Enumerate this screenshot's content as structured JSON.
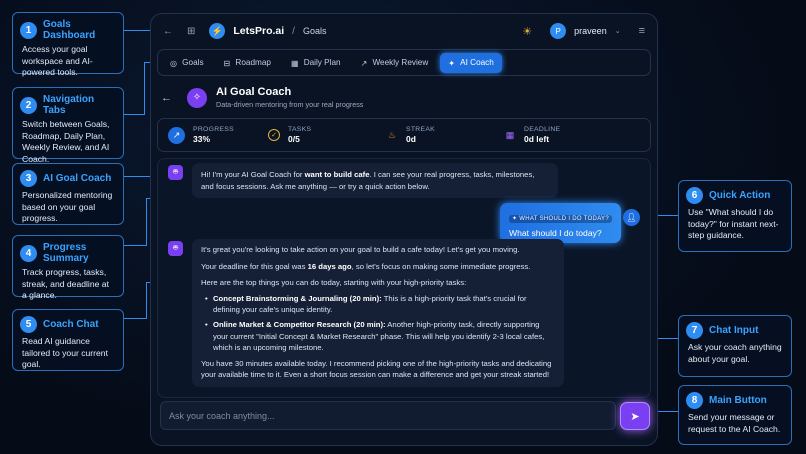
{
  "app": {
    "brand": "LetsPro.ai",
    "separator": "/",
    "breadcrumb": "Goals",
    "user": "praveen",
    "user_initial": "P"
  },
  "tabs": [
    {
      "label": "Goals",
      "icon": "target-icon"
    },
    {
      "label": "Roadmap",
      "icon": "map-icon"
    },
    {
      "label": "Daily Plan",
      "icon": "calendar-icon"
    },
    {
      "label": "Weekly Review",
      "icon": "trend-icon"
    },
    {
      "label": "AI Coach",
      "icon": "sparkle-icon",
      "active": true
    }
  ],
  "header": {
    "title": "AI Goal Coach",
    "subtitle": "Data-driven mentoring from your real progress"
  },
  "stats": [
    {
      "label": "PROGRESS",
      "value": "33%",
      "color": "#2f8cf0"
    },
    {
      "label": "TASKS",
      "value": "0/5",
      "color": "#e0b23a"
    },
    {
      "label": "STREAK",
      "value": "0d",
      "color": "#f08a2f"
    },
    {
      "label": "DEADLINE",
      "value": "0d left",
      "color": "#7b3ff2"
    }
  ],
  "chat": {
    "bot_msg1_a": "Hi! I'm your AI Goal Coach for ",
    "bot_msg1_b": "want to build cafe",
    "bot_msg1_c": ". I can see your real progress, tasks, milestones, and focus sessions. Ask me anything — or try a quick action below.",
    "user_tag": "✦ WHAT SHOULD I DO TODAY?",
    "user_msg": "What should I do today?",
    "bot2_p1": "It's great you're looking to take action on your goal to build a cafe today! Let's get you moving.",
    "bot2_p2a": "Your deadline for this goal was ",
    "bot2_p2b": "16 days ago",
    "bot2_p2c": ", so let's focus on making some immediate progress.",
    "bot2_p3": "Here are the top things you can do today, starting with your high-priority tasks:",
    "item1_title": "Concept Brainstorming & Journaling (20 min):",
    "item1_text": " This is a high-priority task that's crucial for defining your cafe's unique identity.",
    "item2_title": "Online Market & Competitor Research (20 min):",
    "item2_text": " Another high-priority task, directly supporting your current \"Initial Concept & Market Research\" phase. This will help you identify 2-3 local cafes, which is an upcoming milestone.",
    "bot2_p4": "You have 30 minutes available today. I recommend picking one of the high-priority tasks and dedicating your available time to it. Even a short focus session can make a difference and get your streak started!"
  },
  "input": {
    "placeholder": "Ask your coach anything..."
  },
  "callouts": [
    {
      "n": "1",
      "title": "Goals Dashboard",
      "desc": "Access your goal workspace and AI-powered tools."
    },
    {
      "n": "2",
      "title": "Navigation Tabs",
      "desc": "Switch between Goals, Roadmap, Daily Plan, Weekly Review, and AI Coach."
    },
    {
      "n": "3",
      "title": "AI Goal Coach",
      "desc": "Personalized mentoring based on your goal progress."
    },
    {
      "n": "4",
      "title": "Progress Summary",
      "desc": "Track progress, tasks, streak, and deadline at a glance."
    },
    {
      "n": "5",
      "title": "Coach Chat",
      "desc": "Read AI guidance tailored to your current goal."
    },
    {
      "n": "6",
      "title": "Quick Action",
      "desc": "Use \"What should I do today?\" for instant next-step guidance."
    },
    {
      "n": "7",
      "title": "Chat Input",
      "desc": "Ask your coach anything about your goal."
    },
    {
      "n": "8",
      "title": "Main Button",
      "desc": "Send your message or request to the AI Coach."
    }
  ]
}
